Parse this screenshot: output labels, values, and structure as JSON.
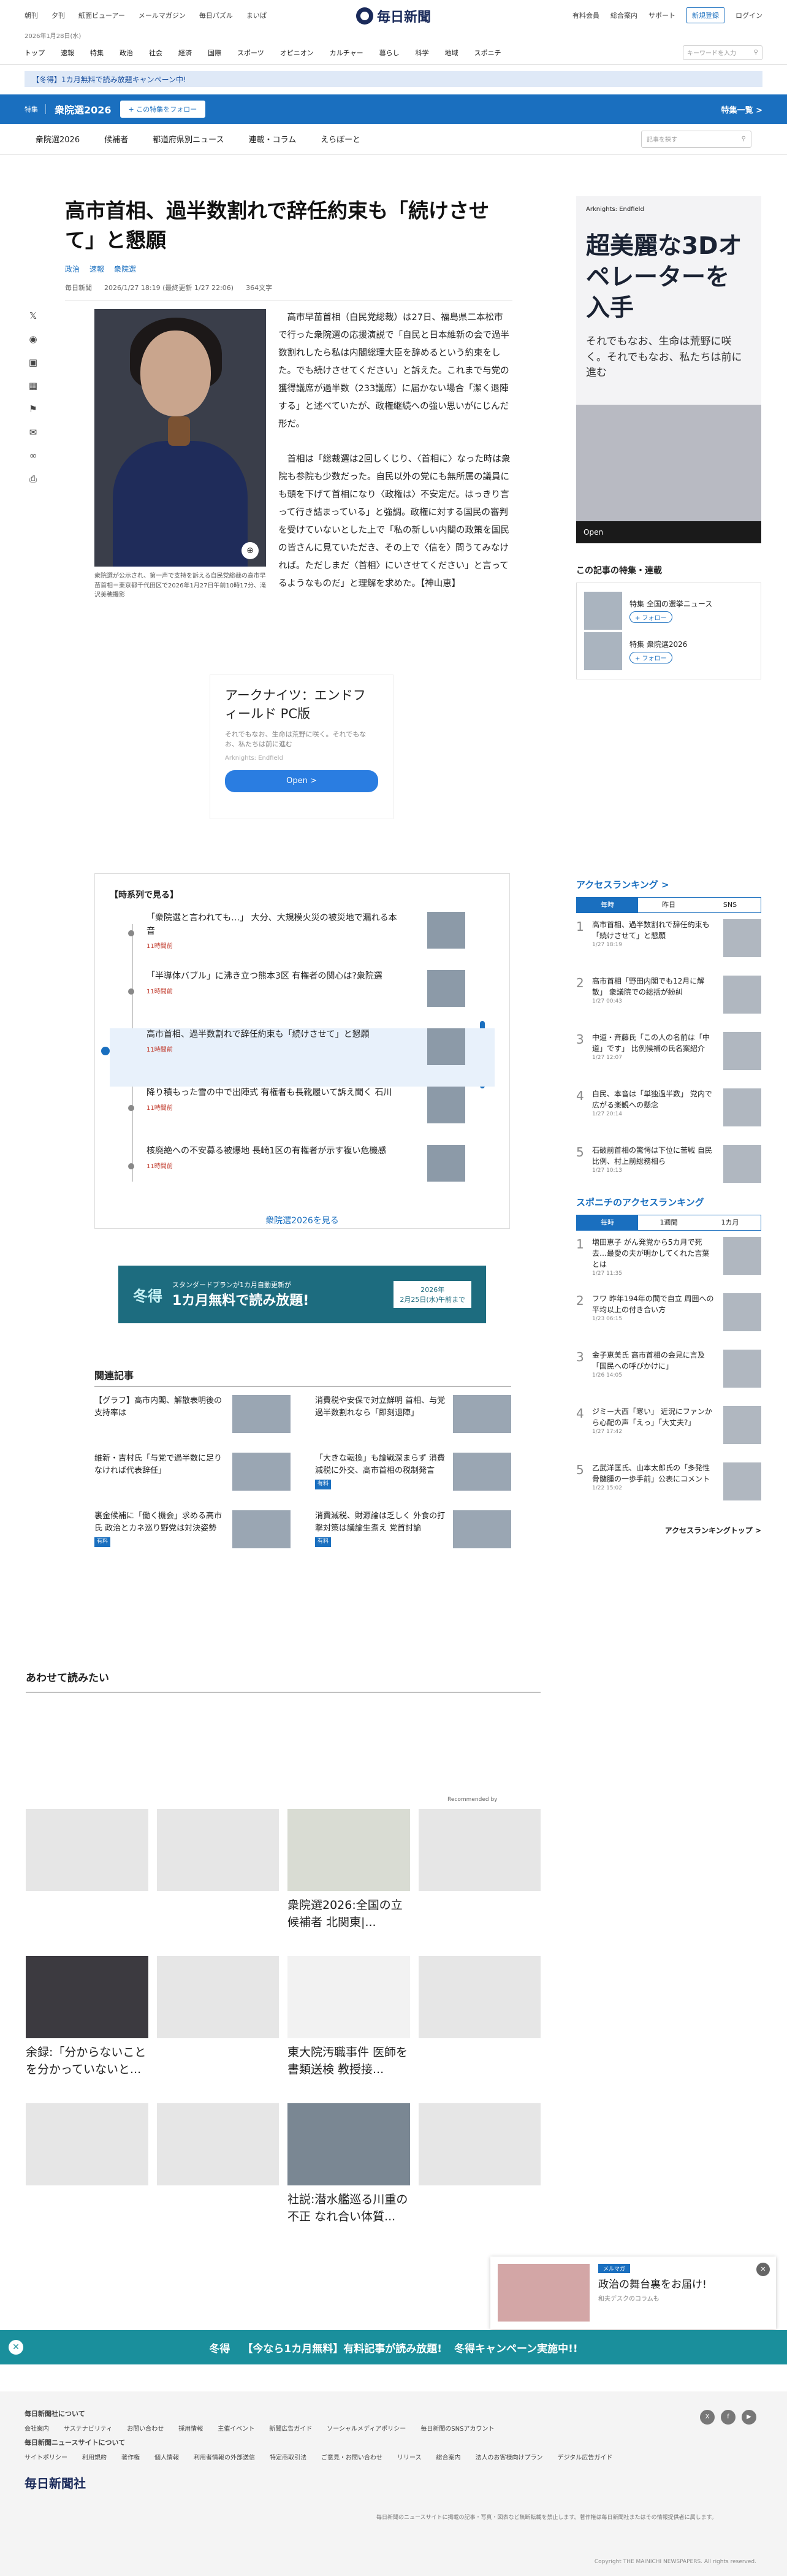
{
  "topbar": {
    "links": [
      "朝刊",
      "夕刊",
      "紙面ビューアー",
      "メールマガジン",
      "毎日パズル",
      "まいぱ"
    ],
    "logo": "毎日新聞",
    "right": [
      "有料会員",
      "総合案内",
      "サポート"
    ],
    "register": "新規登録",
    "login": "ログイン",
    "date": "2026年1月28日(水)"
  },
  "gnav": {
    "items": [
      "トップ",
      "速報",
      "特集",
      "政治",
      "社会",
      "経済",
      "国際",
      "スポーツ",
      "オピニオン",
      "カルチャー",
      "暮らし",
      "科学",
      "地域",
      "スポニチ"
    ],
    "search": "キーワードを入力"
  },
  "promo": "【冬得】1カ月無料で読み放題キャンペーン中!",
  "feature": {
    "tag": "特集",
    "title": "衆院選2026",
    "follow": "+ この特集をフォロー",
    "all": "特集一覧 >"
  },
  "subnav": {
    "items": [
      "衆院選2026",
      "候補者",
      "都道府県別ニュース",
      "連載・コラム",
      "えらぼーと"
    ],
    "search": "記事を探す"
  },
  "article": {
    "title": "高市首相、過半数割れで辞任約束も「続けさせて」と懇願",
    "cats": [
      "政治",
      "速報",
      "衆院選"
    ],
    "source": "毎日新聞",
    "date": "2026/1/27 18:19 (最終更新 1/27 22:06)",
    "chars": "364文字",
    "caption": "衆院選が公示され、第一声で支持を訴える自民党総裁の高市早苗首相＝東京都千代田区で2026年1月27日午前10時17分、滝沢美穂撮影",
    "p1": "高市早苗首相（自民党総裁）は27日、福島県二本松市で行った衆院選の応援演説で「自民と日本維新の会で過半数割れしたら私は内閣総理大臣を辞めるという約束をした。でも続けさせてください」と訴えた。これまで与党の獲得議席が過半数（233議席）に届かない場合「潔く退陣する」と述べていたが、政権継続への強い思いがにじんだ形だ。",
    "p2": "首相は「総裁選は2回しくじり、〈首相に〉なった時は衆院も参院も少数だった。自民以外の党にも無所属の議員にも頭を下げて首相になり〈政権は〉不安定だ。はっきり言って行き詰まっている」と強調。政権に対する国民の審判を受けていないとした上で「私の新しい内閣の政策を国民の皆さんに見ていただき、その上で〈信を〉問うてみなければ。ただしまだ〈首相〉にいさせてください」と言ってるようなものだ」と理解を求めた。【神山恵】"
  },
  "ad_mid": {
    "title": "アークナイツ：エンドフィールド PC版",
    "sub": "それでもなお、生命は荒野に咲く。それでもなお、私たちは前に進む",
    "brand": "Arknights: Endfield",
    "open": "Open >"
  },
  "timeline": {
    "title": "【時系列で見る】",
    "items": [
      {
        "t": "「衆院選と言われても…」 大分、大規模火災の被災地で漏れる本音",
        "m": "11時間前"
      },
      {
        "t": "「半導体バブル」に沸き立つ熊本3区 有権者の関心は?衆院選",
        "m": "11時間前"
      },
      {
        "t": "高市首相、過半数割れで辞任約束も「続けさせて」と懇願",
        "m": "11時間前"
      },
      {
        "t": "降り積もった雪の中で出陣式 有権者も長靴履いて訴え聞く 石川",
        "m": "11時間前"
      },
      {
        "t": "核廃絶への不安募る被爆地 長崎1区の有権者が示す複い危機感",
        "m": "11時間前"
      }
    ],
    "more": "衆院選2026を見る"
  },
  "banner": {
    "w": "冬得",
    "line1": "スタンダードプランが1カ月自動更新が",
    "m": "1カ月無料で読み放題!",
    "right1": "2026年",
    "right2": "2月25日(水)午前まで"
  },
  "related": {
    "title": "関連記事",
    "items": [
      {
        "t": "【グラフ】高市内閣、解散表明後の支持率は"
      },
      {
        "t": "消費税や安保で対立鮮明 首相、与党過半数割れなら「即刻退陣」"
      },
      {
        "t": "維新・吉村氏「与党で過半数に足りなければ代表辞任」"
      },
      {
        "t": "「大きな転換」も論戦深まらず 消費減税に外交、高市首相の税制発言",
        "pr": "有料"
      },
      {
        "t": "裏金候補に「働く機会」求める高市氏 政治とカネ巡り野党は対決姿勢",
        "pr": "有料"
      },
      {
        "t": "消費減税、財源論は乏しく 外食の打撃対策は議論生煮え 党首討論",
        "pr": "有料"
      }
    ]
  },
  "awase": {
    "title": "あわせて読みたい",
    "recommended": "Recommended by",
    "cards": [
      {
        "tx": ""
      },
      {
        "tx": ""
      },
      {
        "tx": "衆院選2026:全国の立候補者 北関東|..."
      },
      {
        "tx": ""
      },
      {
        "tx": "余録:「分からないことを分かっていないと..."
      },
      {
        "tx": ""
      },
      {
        "tx": "東大院汚職事件 医師を書類送検 教授接..."
      },
      {
        "tx": ""
      },
      {
        "tx": ""
      },
      {
        "tx": ""
      },
      {
        "tx": "社説:潜水艦巡る川重の不正 なれ合い体質..."
      },
      {
        "tx": ""
      }
    ]
  },
  "ad_side": {
    "brand": "Arknights: Endfield",
    "title": "超美麗な3Dオペレーターを入手",
    "sub": "それでもなお、生命は荒野に咲く。それでもなお、私たちは前に進む",
    "open": "Open"
  },
  "tokushu": {
    "title": "この記事の特集・連載",
    "items": [
      {
        "l": "特集 全国の選挙ニュース",
        "f": "+ フォロー"
      },
      {
        "l": "特集 衆院選2026",
        "f": "+ フォロー"
      }
    ]
  },
  "rank1": {
    "title": "アクセスランキング >",
    "tabs": [
      "毎時",
      "昨日",
      "SNS"
    ],
    "items": [
      {
        "t": "高市首相、過半数割れで辞任約束も「続けさせて」と懇願",
        "d": "1/27 18:19"
      },
      {
        "t": "高市首相「野田内閣でも12月に解散」 衆議院での総括が紛糾",
        "d": "1/27 00:43"
      },
      {
        "t": "中道・斉藤氏「この人の名前は「中道」です」 比例候補の氏名案紹介",
        "d": "1/27 12:07"
      },
      {
        "t": "自民、本音は「単独過半数」 党内で広がる楽観への懸念",
        "d": "1/27 20:14"
      },
      {
        "t": "石破前首相の驚愕は下位に苦戦 自民比例、村上前総務相ら",
        "d": "1/27 10:13"
      }
    ],
    "more": ""
  },
  "rank2": {
    "title": "スポニチのアクセスランキング",
    "tabs": [
      "毎時",
      "1週間",
      "1カ月"
    ],
    "items": [
      {
        "t": "増田恵子 がん発覚から5カ月で死去…最愛の夫が明かしてくれた言葉とは",
        "d": "1/27 11:35"
      },
      {
        "t": "フワ 昨年194年の間で自立 周囲への平均以上の付き合い方",
        "d": "1/23 06:15"
      },
      {
        "t": "金子恵美氏 高市首相の会見に言及 「国民への呼びかけに」",
        "d": "1/26 14:05"
      },
      {
        "t": "ジミー大西「寒い」 近況にファンから心配の声「えっ」「大丈夫?」",
        "d": "1/27 17:42"
      },
      {
        "t": "乙武洋匡氏、山本太郎氏の「多発性骨髄腫の一歩手前」公表にコメント",
        "d": "1/22 15:02"
      }
    ],
    "more": "アクセスランキングトップ >"
  },
  "popup": {
    "tag": "メルマガ",
    "t": "政治の舞台裏をお届け!",
    "s": "和夫デスクのコラムも"
  },
  "sticky": {
    "w": "冬得",
    "m": "【今なら1カ月無料】有料記事が読み放題!",
    "r": "冬得キャンペーン実施中!!"
  },
  "footer": {
    "h1": "毎日新聞社について",
    "r1": [
      "会社案内",
      "サステナビリティ",
      "お問い合わせ",
      "採用情報",
      "主催イベント",
      "新聞広告ガイド",
      "ソーシャルメディアポリシー",
      "毎日新聞のSNSアカウント"
    ],
    "h2": "毎日新聞ニュースサイトについて",
    "r2": [
      "サイトポリシー",
      "利用規約",
      "著作権",
      "個人情報",
      "利用者情報の外部送信",
      "特定商取引法",
      "ご意見・お問い合わせ",
      "リリース",
      "総合案内",
      "法人のお客様向けプラン",
      "デジタル広告ガイド"
    ],
    "logo": "毎日新聞社",
    "note": "毎日新聞のニュースサイトに掲載の記事・写真・図表など無断転載を禁止します。著作権は毎日新聞社またはその情報提供者に属します。",
    "copy": "Copyright THE MAINICHI NEWSPAPERS. All rights reserved."
  }
}
